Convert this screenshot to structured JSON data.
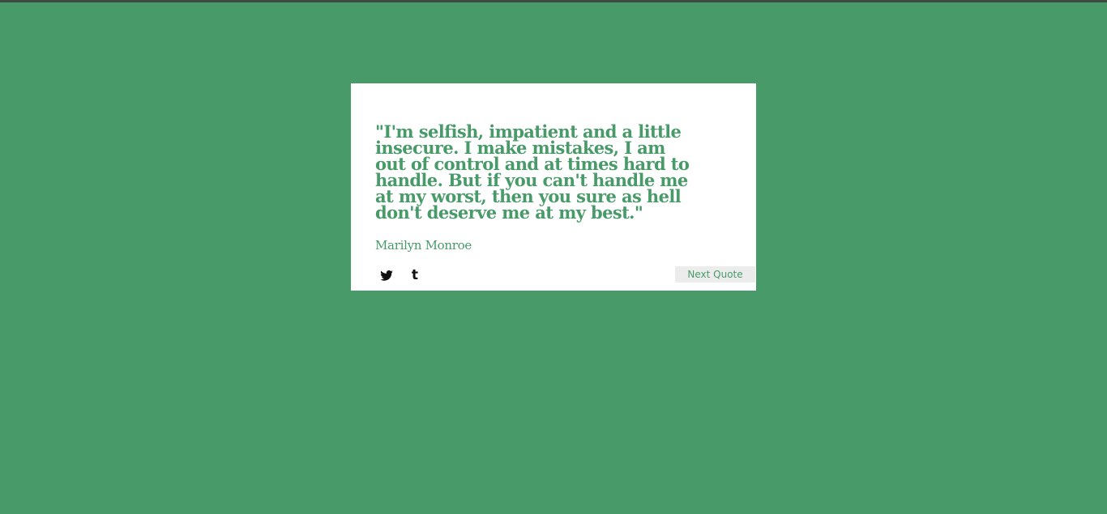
{
  "theme": {
    "background": "#489b69",
    "card_background": "#ffffff",
    "accent": "#489b69",
    "button_background": "#ececec"
  },
  "quote": {
    "text": "\"I'm selfish, impatient and a little insecure. I make mistakes, I am out of control and at times hard to handle. But if you can't handle me at my worst, then you sure as hell don't deserve me at my best.\"",
    "author": "Marilyn Monroe"
  },
  "share": {
    "twitter_icon": "twitter-icon",
    "tumblr_icon": "tumblr-icon",
    "tumblr_glyph": "t"
  },
  "controls": {
    "next_label": "Next Quote"
  }
}
